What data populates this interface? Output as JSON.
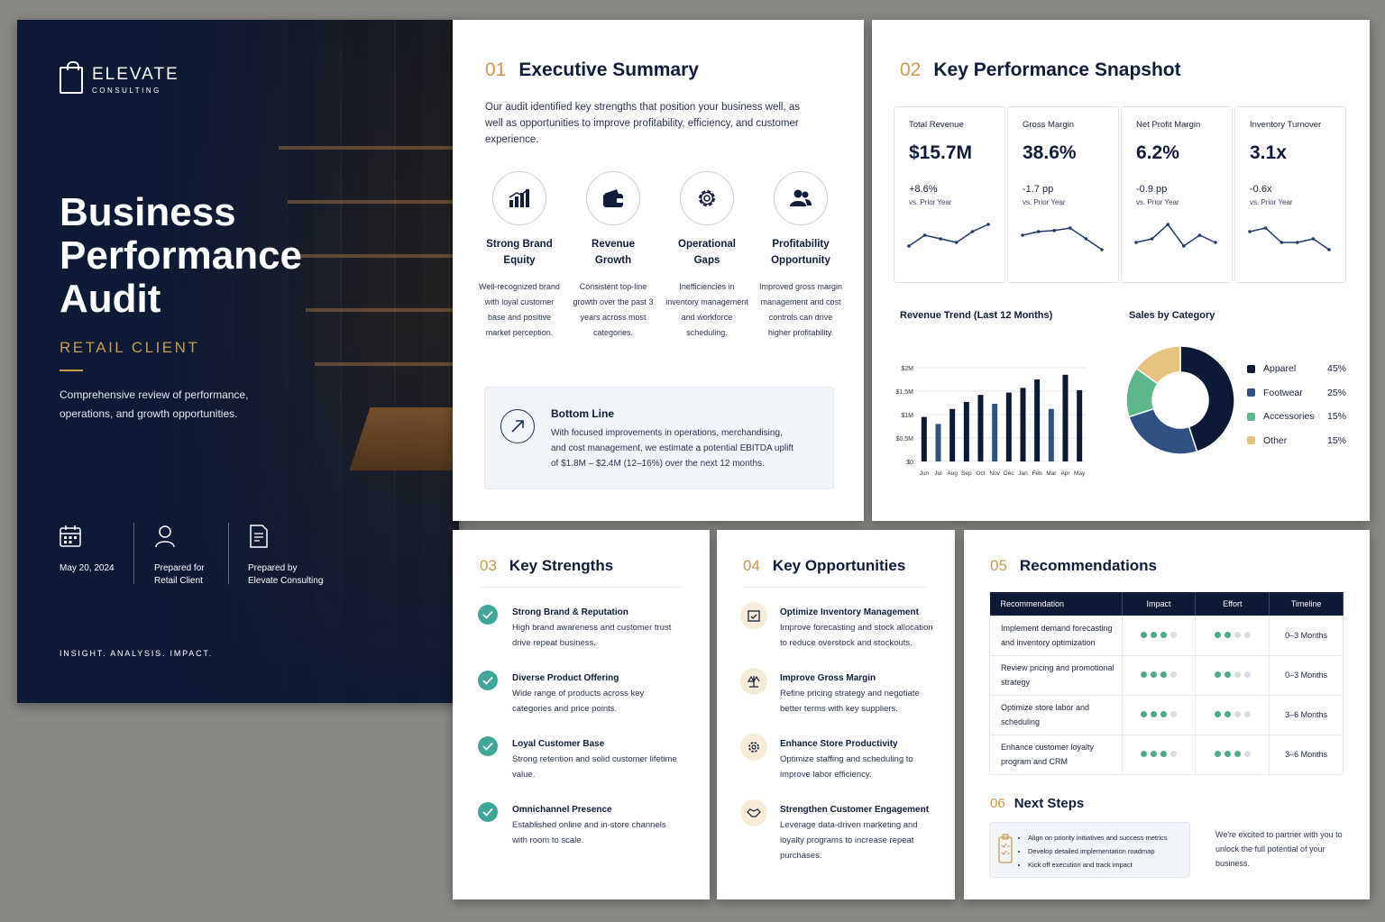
{
  "cover": {
    "logo_name": "ELEVATE",
    "logo_sub": "CONSULTING",
    "title": "Business Performance Audit",
    "client": "RETAIL CLIENT",
    "description": "Comprehensive review of performance, operations, and growth opportunities.",
    "date": "May 20, 2024",
    "prepared_for_label": "Prepared for",
    "prepared_for": "Retail Client",
    "prepared_by_label": "Prepared by",
    "prepared_by": "Elevate Consulting",
    "tagline": "INSIGHT. ANALYSIS. IMPACT."
  },
  "exec": {
    "num": "01",
    "title": "Executive Summary",
    "intro": "Our audit identified key strengths that position your business well, as well as opportunities to improve profitability, efficiency, and customer experience.",
    "pillars": [
      {
        "title": "Strong Brand Equity",
        "text": "Well-recognized brand with loyal customer base and positive market perception.",
        "icon": "bar-chart-icon"
      },
      {
        "title": "Revenue Growth",
        "text": "Consistent top-line growth over the past 3 years across most categories.",
        "icon": "wallet-icon"
      },
      {
        "title": "Operational Gaps",
        "text": "Inefficiencies in inventory management and workforce scheduling.",
        "icon": "gear-icon"
      },
      {
        "title": "Profitability Opportunity",
        "text": "Improved gross margin management and cost controls can drive higher profitability.",
        "icon": "people-icon"
      }
    ],
    "bottom_line_title": "Bottom Line",
    "bottom_line_text": "With focused improvements in operations, merchandising, and cost management, we estimate a potential EBITDA uplift of $1.8M – $2.4M (12–16%) over the next 12 months."
  },
  "kpi": {
    "num": "02",
    "title": "Key Performance Snapshot",
    "cards": [
      {
        "label": "Total Revenue",
        "value": "$15.7M",
        "delta": "+8.6%",
        "sub": "vs. Prior Year",
        "spark": [
          2,
          5,
          4,
          3,
          6,
          8
        ]
      },
      {
        "label": "Gross Margin",
        "value": "38.6%",
        "delta": "-1.7 pp",
        "sub": "vs. Prior Year",
        "spark": [
          5,
          6,
          6.3,
          7,
          4,
          1
        ]
      },
      {
        "label": "Net Profit Margin",
        "value": "6.2%",
        "delta": "-0.9 pp",
        "sub": "vs. Prior Year",
        "spark": [
          3,
          4,
          8,
          2,
          5,
          3
        ]
      },
      {
        "label": "Inventory Turnover",
        "value": "3.1x",
        "delta": "-0.6x",
        "sub": "vs. Prior Year",
        "spark": [
          6,
          7,
          3,
          3,
          4,
          1
        ]
      }
    ]
  },
  "chart_data": [
    {
      "type": "bar",
      "title": "Revenue Trend (Last 12 Months)",
      "categories": [
        "Jun",
        "Jul",
        "Aug",
        "Sep",
        "Oct",
        "Nov",
        "Dec",
        "Jan",
        "Feb",
        "Mar",
        "Apr",
        "May"
      ],
      "yticks": [
        "$0",
        "$0.5M",
        "$1M",
        "$1.5M",
        "$2M"
      ],
      "ylim": [
        0,
        2
      ],
      "values": [
        0.95,
        0.8,
        1.12,
        1.27,
        1.42,
        1.23,
        1.47,
        1.57,
        1.75,
        1.12,
        1.85,
        1.52
      ],
      "colors": [
        "#0d1a35",
        "#2f5282",
        "#0d1a35",
        "#0d1a35",
        "#0d1a35",
        "#2f5282",
        "#0d1a35",
        "#0d1a35",
        "#0d1a35",
        "#2f5282",
        "#0d1a35",
        "#0d1a35"
      ]
    },
    {
      "type": "pie",
      "title": "Sales by Category",
      "labels": [
        "Apparel",
        "Footwear",
        "Accessories",
        "Other"
      ],
      "values": [
        45,
        25,
        15,
        15
      ],
      "display": [
        "45%",
        "25%",
        "15%",
        "15%"
      ],
      "colors": [
        "#0d1a35",
        "#2f5282",
        "#5cb88a",
        "#e6c37e"
      ]
    }
  ],
  "strengths": {
    "num": "03",
    "title": "Key Strengths",
    "items": [
      {
        "title": "Strong Brand & Reputation",
        "text": "High brand awareness and customer trust drive repeat business."
      },
      {
        "title": "Diverse Product Offering",
        "text": "Wide range of products across key categories and price points."
      },
      {
        "title": "Loyal Customer Base",
        "text": "Strong retention and solid customer lifetime value."
      },
      {
        "title": "Omnichannel Presence",
        "text": "Established online and in-store channels with room to scale."
      }
    ]
  },
  "opps": {
    "num": "04",
    "title": "Key Opportunities",
    "items": [
      {
        "title": "Optimize Inventory Management",
        "text": "Improve forecasting and stock allocation to reduce overstock and stockouts."
      },
      {
        "title": "Improve Gross Margin",
        "text": "Refine pricing strategy and negotiate better terms with key suppliers."
      },
      {
        "title": "Enhance Store Productivity",
        "text": "Optimize staffing and scheduling to improve labor efficiency."
      },
      {
        "title": "Strengthen Customer Engagement",
        "text": "Leverage data-driven marketing and loyalty programs to increase repeat purchases."
      }
    ]
  },
  "recs": {
    "num": "05",
    "title": "Recommendations",
    "headers": [
      "Recommendation",
      "Impact",
      "Effort",
      "Timeline"
    ],
    "rows": [
      {
        "rec": "Implement demand forecasting and inventory optimization",
        "impact": 3,
        "effort": 2,
        "timeline": "0–3 Months"
      },
      {
        "rec": "Review pricing and promotional strategy",
        "impact": 3,
        "effort": 2,
        "timeline": "0–3 Months"
      },
      {
        "rec": "Optimize store labor and scheduling",
        "impact": 3,
        "effort": 2,
        "timeline": "3–6 Months"
      },
      {
        "rec": "Enhance customer loyalty program and CRM",
        "impact": 3,
        "effort": 3,
        "timeline": "3–6 Months"
      }
    ],
    "dots_total": 4,
    "next_num": "06",
    "next_title": "Next Steps",
    "next_steps": [
      "Align on priority initiatives and success metrics",
      "Develop detailed implementation roadmap",
      "Kick off execution and track impact"
    ],
    "closing": "We're excited to partner with you to unlock the full potential of your business."
  },
  "colors": {
    "navy": "#0d1a35",
    "gold": "#c99a4c",
    "teal": "#3fa79a",
    "dot_on": "#4dab8c",
    "dot_off": "#d8dce3"
  }
}
